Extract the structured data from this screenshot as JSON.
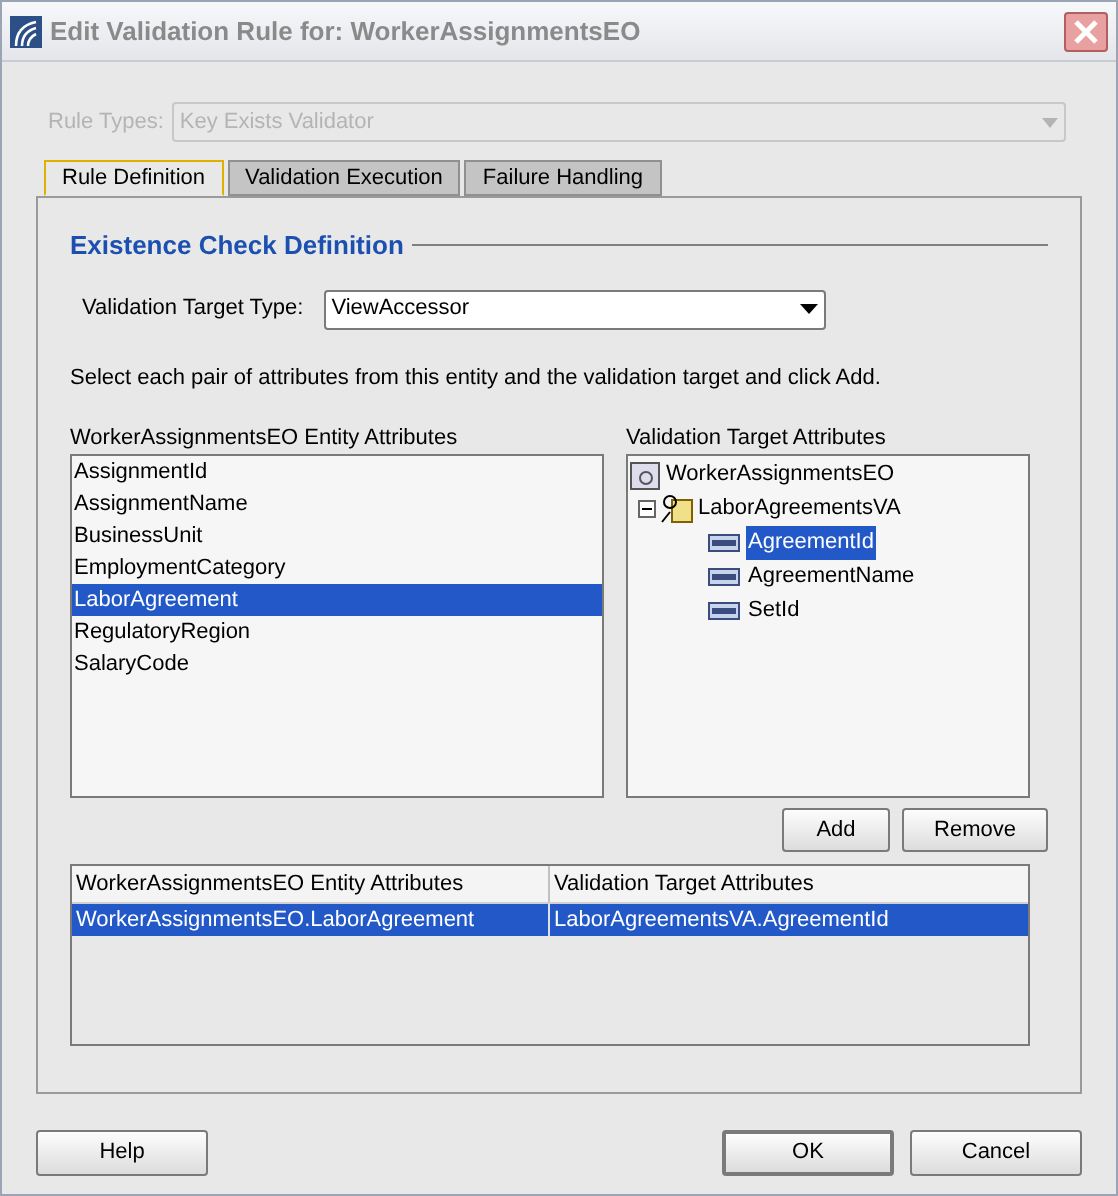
{
  "window": {
    "title": "Edit Validation Rule for: WorkerAssignmentsEO"
  },
  "rule_types": {
    "label": "Rule Types:",
    "value": "Key Exists Validator",
    "disabled": true
  },
  "tabs": [
    {
      "label": "Rule Definition",
      "selected": true
    },
    {
      "label": "Validation Execution",
      "selected": false
    },
    {
      "label": "Failure Handling",
      "selected": false
    }
  ],
  "section_title": "Existence Check Definition",
  "target_type": {
    "label": "Validation Target Type:",
    "value": "ViewAccessor"
  },
  "instruction": "Select each pair of attributes from this entity and the validation target and click Add.",
  "entity_list": {
    "label": "WorkerAssignmentsEO Entity Attributes",
    "items": [
      {
        "label": "AssignmentId",
        "selected": false
      },
      {
        "label": "AssignmentName",
        "selected": false
      },
      {
        "label": "BusinessUnit",
        "selected": false
      },
      {
        "label": "EmploymentCategory",
        "selected": false
      },
      {
        "label": "LaborAgreement",
        "selected": true
      },
      {
        "label": "RegulatoryRegion",
        "selected": false
      },
      {
        "label": "SalaryCode",
        "selected": false
      }
    ]
  },
  "target_tree": {
    "label": "Validation Target Attributes",
    "root": {
      "label": "WorkerAssignmentsEO",
      "children": [
        {
          "label": "LaborAgreementsVA",
          "expanded": true,
          "children": [
            {
              "label": "AgreementId",
              "selected": true
            },
            {
              "label": "AgreementName",
              "selected": false
            },
            {
              "label": "SetId",
              "selected": false
            }
          ]
        }
      ]
    }
  },
  "list_buttons": [
    "Add",
    "Remove"
  ],
  "table": {
    "columns": [
      "WorkerAssignmentsEO Entity Attributes",
      "Validation Target Attributes"
    ],
    "rows": [
      {
        "cells": [
          "WorkerAssignmentsEO.LaborAgreement",
          "LaborAgreementsVA.AgreementId"
        ],
        "selected": true
      }
    ]
  },
  "footer_buttons": [
    {
      "label": "Help",
      "kind": "normal"
    },
    {
      "label": "OK",
      "kind": "default"
    },
    {
      "label": "Cancel",
      "kind": "normal"
    }
  ]
}
